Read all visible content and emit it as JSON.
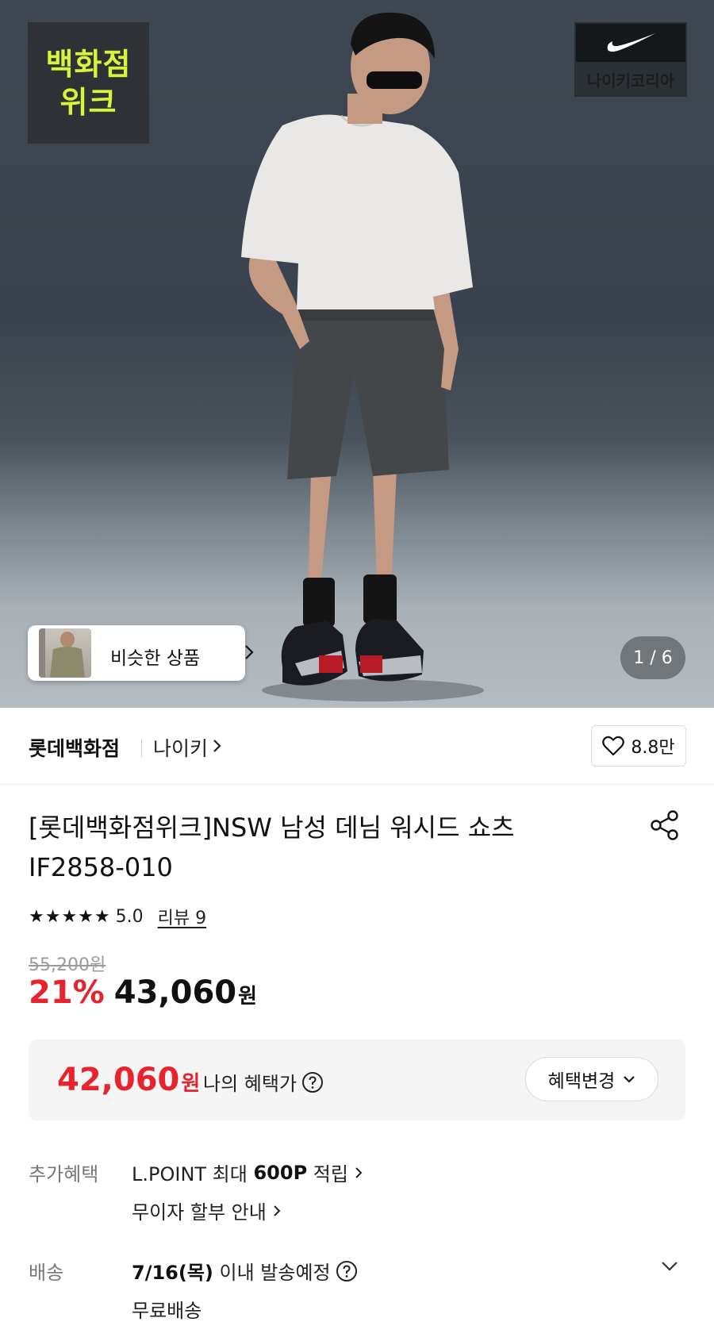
{
  "hero": {
    "badge_line1": "백화점",
    "badge_line2": "위크",
    "brand_badge_text": "나이키코리아",
    "similar_label": "비슷한 상품",
    "counter": "1 / 6"
  },
  "store": {
    "name": "롯데백화점",
    "brand": "나이키",
    "likes": "8.8만"
  },
  "product": {
    "title_line1": "[롯데백화점위크]NSW 남성 데님 워시드 쇼츠",
    "title_line2": "IF2858-010",
    "stars": "★★★★★",
    "rating": "5.0",
    "review_label": "리뷰 9"
  },
  "price": {
    "original": "55,200원",
    "discount": "21%",
    "sale": "43,060",
    "sale_unit": "원"
  },
  "benefit": {
    "price": "42,060",
    "unit": "원",
    "label": "나의 혜택가",
    "change_label": "혜택변경"
  },
  "extra": {
    "label": "추가혜택",
    "lpoint_prefix": "L.POINT 최대 ",
    "lpoint_amount": "600P",
    "lpoint_suffix": " 적립",
    "installment": "무이자 할부 안내"
  },
  "shipping": {
    "label": "배송",
    "date": "7/16(목)",
    "date_suffix": " 이내 발송예정",
    "free": "무료배송"
  },
  "colors": {
    "accent_red": "#e7242e",
    "badge_green": "#d8f43a"
  }
}
